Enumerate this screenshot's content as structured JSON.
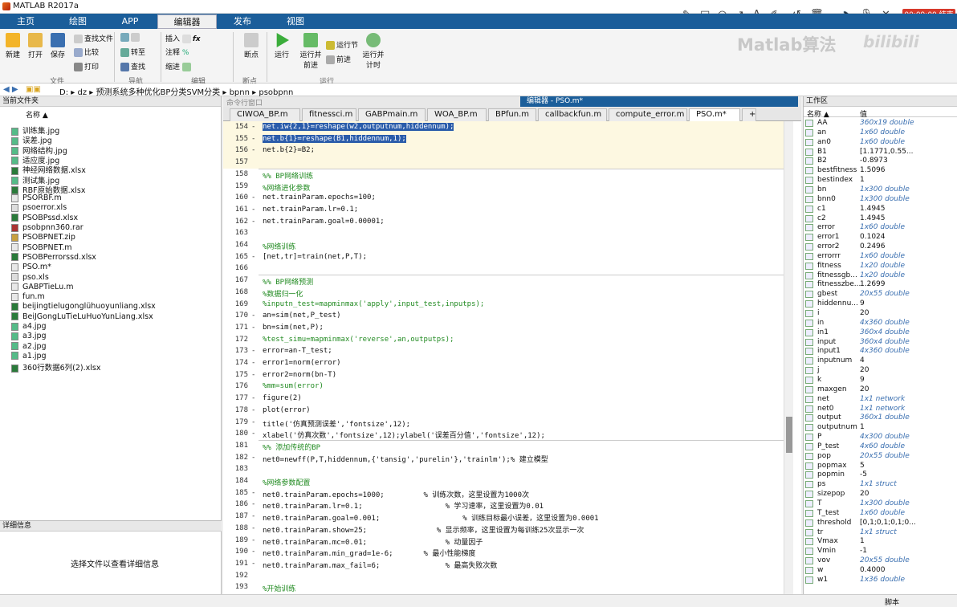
{
  "app": {
    "title": "MATLAB R2017a"
  },
  "tabs": [
    "主页",
    "绘图",
    "APP",
    "编辑器",
    "发布",
    "视图"
  ],
  "ribbon": {
    "new": "新建",
    "open": "打开",
    "save": "保存",
    "find_files": "查找文件",
    "compare": "比较",
    "print": "打印",
    "goto": "转至",
    "find": "查找",
    "insert": "插入",
    "fx": "fx",
    "comment": "注释",
    "pct": "%",
    "indent": "缩进",
    "breakpoints": "断点",
    "run": "运行",
    "run_advance": "运行并\n前进",
    "run_section": "运行节",
    "advance": "前进",
    "run_time": "运行并\n计时",
    "groups": [
      "文件",
      "导航",
      "编辑",
      "断点",
      "运行"
    ]
  },
  "annot": {
    "timer": "00:09:00 结束"
  },
  "watermark": "Matlab算法",
  "bilibili": "bilibili",
  "address": {
    "parts": [
      "D:",
      "dz",
      "预测系统多种优化BP分类SVM分类",
      "bpnn",
      "psobpnn"
    ]
  },
  "left": {
    "title": "当前文件夹",
    "col": "名称 ▲",
    "files": [
      "训练集.jpg",
      "误差.jpg",
      "网络结构.jpg",
      "适应度.jpg",
      "神经网络数据.xlsx",
      "测试集.jpg",
      "RBF原始数据.xlsx",
      "PSORBF.m",
      "psoerror.xls",
      "PSOBPssd.xlsx",
      "psobpnn360.rar",
      "PSOBPNET.zip",
      "PSOBPNET.m",
      "PSOBPerrorssd.xlsx",
      "PSO.m*",
      "pso.xls",
      "GABPTieLu.m",
      "fun.m",
      "beijingtielugonglühuoyunliang.xlsx",
      "BeiJGongLuTieLuHuoYunLiang.xlsx",
      "a4.jpg",
      "a3.jpg",
      "a2.jpg",
      "a1.jpg",
      "360行数据6列(2).xlsx"
    ],
    "details_title": "详细信息",
    "details_msg": "选择文件以查看详细信息"
  },
  "editor": {
    "cmd_title": "命令行窗口",
    "title": "编辑器 - PSO.m*",
    "tabs": [
      "CIWOA_BP.m",
      "fitnessci.m",
      "GABPmain.m",
      "WOA_BP.m",
      "BPfun.m",
      "callbackfun.m",
      "compute_error.m",
      "PSO.m*",
      "+"
    ],
    "lines": [
      {
        "n": "154",
        "d": "-",
        "t": "net.iw{2,1}=reshape(w2,outputnum,hiddennum);",
        "k": "hl"
      },
      {
        "n": "155",
        "d": "-",
        "t": "net.b{1}=reshape(B1,hiddennum,1);",
        "k": "hl"
      },
      {
        "n": "156",
        "d": "-",
        "t": "net.b{2}=B2;",
        "k": ""
      },
      {
        "n": "157",
        "d": "",
        "t": "",
        "k": ""
      },
      {
        "n": "158",
        "d": "",
        "t": "%% BP网络训练",
        "k": "cm"
      },
      {
        "n": "159",
        "d": "",
        "t": "%网络进化参数",
        "k": "cm"
      },
      {
        "n": "160",
        "d": "-",
        "t": "net.trainParam.epochs=100;",
        "k": ""
      },
      {
        "n": "161",
        "d": "-",
        "t": "net.trainParam.lr=0.1;",
        "k": ""
      },
      {
        "n": "162",
        "d": "-",
        "t": "net.trainParam.goal=0.00001;",
        "k": ""
      },
      {
        "n": "163",
        "d": "",
        "t": "",
        "k": ""
      },
      {
        "n": "164",
        "d": "",
        "t": "%网络训练",
        "k": "cm"
      },
      {
        "n": "165",
        "d": "-",
        "t": "[net,tr]=train(net,P,T);",
        "k": ""
      },
      {
        "n": "166",
        "d": "",
        "t": "",
        "k": ""
      },
      {
        "n": "167",
        "d": "",
        "t": "%% BP网络预测",
        "k": "cm"
      },
      {
        "n": "168",
        "d": "",
        "t": "%数据归一化",
        "k": "cm"
      },
      {
        "n": "169",
        "d": "",
        "t": "%inputn_test=mapminmax('apply',input_test,inputps);",
        "k": "cm"
      },
      {
        "n": "170",
        "d": "-",
        "t": "an=sim(net,P_test)",
        "k": ""
      },
      {
        "n": "171",
        "d": "-",
        "t": "bn=sim(net,P);",
        "k": ""
      },
      {
        "n": "172",
        "d": "",
        "t": "%test_simu=mapminmax('reverse',an,outputps);",
        "k": "cm"
      },
      {
        "n": "173",
        "d": "-",
        "t": "error=an-T_test;",
        "k": ""
      },
      {
        "n": "174",
        "d": "-",
        "t": "error1=norm(error)",
        "k": ""
      },
      {
        "n": "175",
        "d": "-",
        "t": "error2=norm(bn-T)",
        "k": ""
      },
      {
        "n": "176",
        "d": "",
        "t": "%mm=sum(error)",
        "k": "cm"
      },
      {
        "n": "177",
        "d": "-",
        "t": "figure(2)",
        "k": ""
      },
      {
        "n": "178",
        "d": "-",
        "t": "plot(error)",
        "k": ""
      },
      {
        "n": "179",
        "d": "-",
        "t": "title('仿真预测误差','fontsize',12);",
        "k": ""
      },
      {
        "n": "180",
        "d": "-",
        "t": "xlabel('仿真次数','fontsize',12);ylabel('误差百分值','fontsize',12);",
        "k": ""
      },
      {
        "n": "181",
        "d": "",
        "t": "%% 添加传统的BP",
        "k": "cm"
      },
      {
        "n": "182",
        "d": "-",
        "t": "net0=newff(P,T,hiddennum,{'tansig','purelin'},'trainlm');% 建立模型",
        "k": ""
      },
      {
        "n": "183",
        "d": "",
        "t": "",
        "k": ""
      },
      {
        "n": "184",
        "d": "",
        "t": "%网络参数配置",
        "k": "cm"
      },
      {
        "n": "185",
        "d": "-",
        "t": "net0.trainParam.epochs=1000;         % 训练次数，这里设置为1000次",
        "k": ""
      },
      {
        "n": "186",
        "d": "-",
        "t": "net0.trainParam.lr=0.1;                   % 学习速率，这里设置为0.01",
        "k": ""
      },
      {
        "n": "187",
        "d": "-",
        "t": "net0.trainParam.goal=0.001;                   % 训练目标最小误差，这里设置为0.0001",
        "k": ""
      },
      {
        "n": "188",
        "d": "-",
        "t": "net0.trainParam.show=25;                % 显示频率，这里设置为每训练25次显示一次",
        "k": ""
      },
      {
        "n": "189",
        "d": "-",
        "t": "net0.trainParam.mc=0.01;                  % 动量因子",
        "k": ""
      },
      {
        "n": "190",
        "d": "-",
        "t": "net0.trainParam.min_grad=1e-6;       % 最小性能梯度",
        "k": ""
      },
      {
        "n": "191",
        "d": "-",
        "t": "net0.trainParam.max_fail=6;               % 最高失败次数",
        "k": ""
      },
      {
        "n": "192",
        "d": "",
        "t": "",
        "k": ""
      },
      {
        "n": "193",
        "d": "",
        "t": "%开始训练",
        "k": "cm"
      }
    ]
  },
  "workspace": {
    "title": "工作区",
    "col_name": "名称 ▲",
    "col_value": "值",
    "vars": [
      [
        "AA",
        "360x19 double",
        1
      ],
      [
        "an",
        "1x60 double",
        1
      ],
      [
        "an0",
        "1x60 double",
        1
      ],
      [
        "B1",
        "[1.1771,0.55...",
        0
      ],
      [
        "B2",
        "-0.8973",
        0
      ],
      [
        "bestfitness",
        "1.5096",
        0
      ],
      [
        "bestindex",
        "1",
        0
      ],
      [
        "bn",
        "1x300 double",
        1
      ],
      [
        "bnn0",
        "1x300 double",
        1
      ],
      [
        "c1",
        "1.4945",
        0
      ],
      [
        "c2",
        "1.4945",
        0
      ],
      [
        "error",
        "1x60 double",
        1
      ],
      [
        "error1",
        "0.1024",
        0
      ],
      [
        "error2",
        "0.2496",
        0
      ],
      [
        "errorrr",
        "1x60 double",
        1
      ],
      [
        "fitness",
        "1x20 double",
        1
      ],
      [
        "fitnessgb...",
        "1x20 double",
        1
      ],
      [
        "fitnesszbe...",
        "1.2699",
        0
      ],
      [
        "gbest",
        "20x55 double",
        1
      ],
      [
        "hiddennu...",
        "9",
        0
      ],
      [
        "i",
        "20",
        0
      ],
      [
        "in",
        "4x360 double",
        1
      ],
      [
        "in1",
        "360x4 double",
        1
      ],
      [
        "input",
        "360x4 double",
        1
      ],
      [
        "input1",
        "4x360 double",
        1
      ],
      [
        "inputnum",
        "4",
        0
      ],
      [
        "j",
        "20",
        0
      ],
      [
        "k",
        "9",
        0
      ],
      [
        "maxgen",
        "20",
        0
      ],
      [
        "net",
        "1x1 network",
        1
      ],
      [
        "net0",
        "1x1 network",
        1
      ],
      [
        "output",
        "360x1 double",
        1
      ],
      [
        "outputnum",
        "1",
        0
      ],
      [
        "P",
        "4x300 double",
        1
      ],
      [
        "P_test",
        "4x60 double",
        1
      ],
      [
        "pop",
        "20x55 double",
        1
      ],
      [
        "popmax",
        "5",
        0
      ],
      [
        "popmin",
        "-5",
        0
      ],
      [
        "ps",
        "1x1 struct",
        1
      ],
      [
        "sizepop",
        "20",
        0
      ],
      [
        "T",
        "1x300 double",
        1
      ],
      [
        "T_test",
        "1x60 double",
        1
      ],
      [
        "threshold",
        "[0,1;0,1;0,1;0...",
        0
      ],
      [
        "tr",
        "1x1 struct",
        1
      ],
      [
        "Vmax",
        "1",
        0
      ],
      [
        "Vmin",
        "-1",
        0
      ],
      [
        "vov",
        "20x55 double",
        1
      ],
      [
        "w",
        "0.4000",
        0
      ],
      [
        "w1",
        "1x36 double",
        1
      ]
    ]
  },
  "status": {
    "right": "脚本"
  }
}
